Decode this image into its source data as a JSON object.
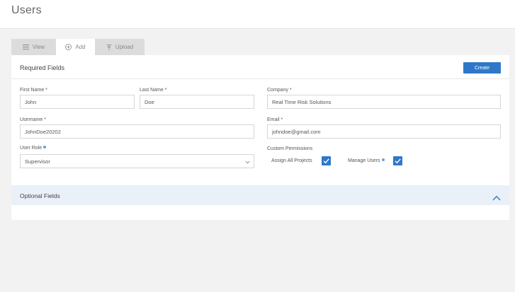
{
  "page": {
    "title": "Users"
  },
  "tabs": [
    {
      "label": "View",
      "icon": "list-icon",
      "active": false
    },
    {
      "label": "Add",
      "icon": "plus-circle-icon",
      "active": true
    },
    {
      "label": "Upload",
      "icon": "upload-icon",
      "active": false
    }
  ],
  "required": {
    "title": "Required Fields",
    "create_label": "Create",
    "first_name": {
      "label": "First Name *",
      "value": "John"
    },
    "last_name": {
      "label": "Last Name *",
      "value": "Doe"
    },
    "company": {
      "label": "Company *",
      "value": "Real Time Risk Solutions"
    },
    "username": {
      "label": "Username *",
      "value": "JohnDoe20202"
    },
    "email": {
      "label": "Email *",
      "value": "johndoe@gmail.com"
    },
    "user_role": {
      "label": "User Role",
      "value": "Supervisor"
    },
    "permissions": {
      "label": "Custom Permissions",
      "assign_all_projects": {
        "label": "Assign All Projects",
        "checked": true
      },
      "manage_users": {
        "label": "Manage Users",
        "checked": true
      }
    }
  },
  "optional": {
    "title": "Optional Fields",
    "expanded": false
  },
  "colors": {
    "accent": "#2f78c8",
    "optional_bar": "#e9f0f8"
  }
}
